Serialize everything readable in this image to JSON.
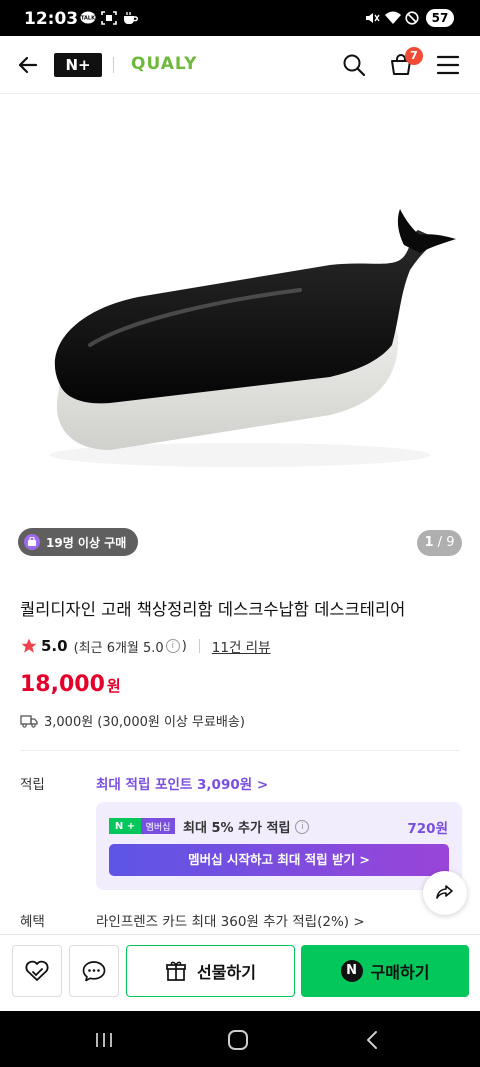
{
  "status_bar": {
    "time": "12:03",
    "battery": "57",
    "left_icons": [
      "talk-icon",
      "screenshot-icon",
      "coffee-icon"
    ],
    "right_icons": [
      "mute-icon",
      "wifi-icon",
      "do-not-disturb-icon"
    ]
  },
  "header": {
    "logo_mark": "N+",
    "brand": "QUALY",
    "cart_count": "7",
    "icons": [
      "back-arrow-icon",
      "search-icon",
      "cart-icon",
      "menu-icon"
    ]
  },
  "gallery": {
    "age_badge": "19명 이상 구매",
    "page_current": "1",
    "page_total": "9"
  },
  "product": {
    "title": "퀄리디자인 고래 책상정리함 데스크수납함 데스크테리어",
    "rating": "5.0",
    "rating_detail": "(최근 6개월 5.0",
    "rating_close": ")",
    "reviews": "11건 리뷰",
    "price": "18,000",
    "currency": "원",
    "shipping": "3,000원 (30,000원 이상 무료배송)"
  },
  "points": {
    "label": "적립",
    "max_points": "최대 적립 포인트 3,090원 >",
    "np_mark": "N +",
    "membership_tag": "멤버십",
    "member_extra": "최대 5% 추가 적립",
    "member_points": "720원",
    "member_cta": "멤버십 시작하고 최대 적립 받기 >"
  },
  "benefit": {
    "label": "혜택",
    "text": "라인프렌즈 카드 최대 360원 추가 적립(2%) >"
  },
  "bottom_bar": {
    "gift_label": "선물하기",
    "buy_label": "구매하기",
    "buy_mark": "N"
  },
  "colors": {
    "naver_green": "#03c75a",
    "price_red": "#e4002b",
    "purple": "#7a4fe0",
    "brand_green": "#6fb83c"
  }
}
